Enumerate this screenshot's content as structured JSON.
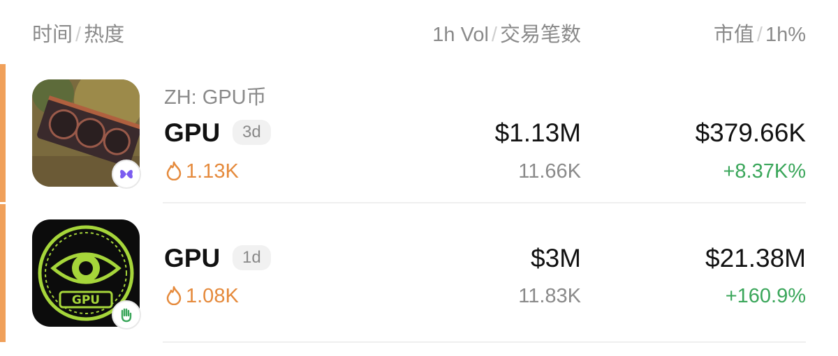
{
  "header": {
    "col1_a": "时间",
    "col1_b": "热度",
    "col2_a": "1h Vol",
    "col2_b": "交易笔数",
    "col3_a": "市值",
    "col3_b": "1h%",
    "separator": "/"
  },
  "tokens": [
    {
      "subtitle": "ZH: GPU币",
      "name": "GPU",
      "age": "3d",
      "heat": "1.13K",
      "volume": "$1.13M",
      "tx_count": "11.66K",
      "market_cap": "$379.66K",
      "change_1h": "+8.37K%",
      "badge_icon": "butterfly-icon",
      "avatar_icon": "gpu-card-image"
    },
    {
      "name": "GPU",
      "age": "1d",
      "heat": "1.08K",
      "volume": "$3M",
      "tx_count": "11.83K",
      "market_cap": "$21.38M",
      "change_1h": "+160.9%",
      "badge_icon": "wave-hand-icon",
      "avatar_icon": "gpu-eye-logo"
    }
  ],
  "colors": {
    "accent": "#f0a05a",
    "heat": "#e58a3c",
    "positive": "#3aa65a",
    "muted": "#8a8a8a"
  }
}
